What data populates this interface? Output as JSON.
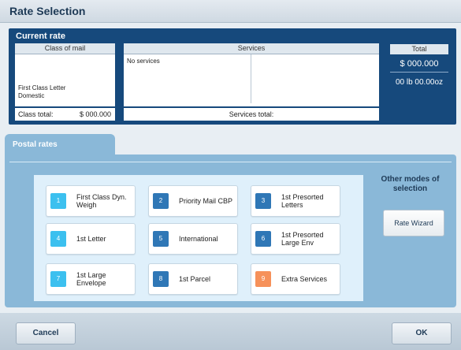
{
  "window": {
    "title": "Rate Selection"
  },
  "current_rate": {
    "header": "Current rate",
    "class_of_mail": {
      "heading": "Class of mail",
      "line1": "First Class Letter",
      "line2": "Domestic",
      "total_label": "Class total:",
      "total_value": "$ 000.000"
    },
    "services": {
      "heading": "Services",
      "text": "No services",
      "total_label": "Services total:"
    },
    "total": {
      "heading": "Total",
      "amount": "$ 000.000",
      "weight": "00 lb 00.00oz"
    }
  },
  "postal_rates": {
    "tab_label": "Postal rates",
    "buttons": [
      {
        "num": "1",
        "label": "First Class Dyn. Weigh",
        "color": "#3cc0ef"
      },
      {
        "num": "2",
        "label": "Priority Mail CBP",
        "color": "#2f77b6"
      },
      {
        "num": "3",
        "label": "1st Presorted Letters",
        "color": "#2f77b6"
      },
      {
        "num": "4",
        "label": "1st Letter",
        "color": "#3cc0ef"
      },
      {
        "num": "5",
        "label": "International",
        "color": "#2f77b6"
      },
      {
        "num": "6",
        "label": "1st Presorted Large Env",
        "color": "#2f77b6"
      },
      {
        "num": "7",
        "label": "1st Large Envelope",
        "color": "#3cc0ef"
      },
      {
        "num": "8",
        "label": "1st Parcel",
        "color": "#2f77b6"
      },
      {
        "num": "9",
        "label": "Extra Services",
        "color": "#f6915a"
      }
    ]
  },
  "other_modes": {
    "label": "Other modes of selection",
    "wizard_label": "Rate Wizard"
  },
  "footer": {
    "cancel_label": "Cancel",
    "ok_label": "OK"
  }
}
